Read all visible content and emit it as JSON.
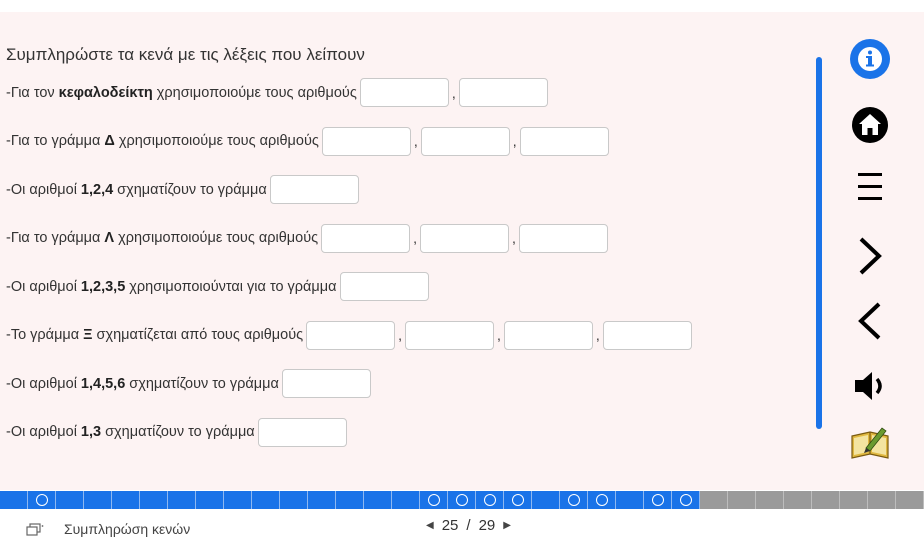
{
  "exercise": {
    "title": "Συμπληρώστε τα κενά με τις λέξεις που λείπουν",
    "lines": [
      {
        "pre": "-Για τον",
        "bold": "κεφαλοδείκτη",
        "post": "χρησιμοποιούμε τους αριθμούς"
      },
      {
        "pre": "-Για το γράμμα",
        "bold": "Δ",
        "post": "χρησιμοποιούμε τους αριθμούς"
      },
      {
        "pre": "-Οι αριθμοί",
        "bold": "1,2,4",
        "post": "σχηματίζουν το γράμμα"
      },
      {
        "pre": "-Για το γράμμα",
        "bold": "Λ",
        "post": "χρησιμοποιούμε τους αριθμούς"
      },
      {
        "pre": "-Οι αριθμοί",
        "bold": "1,2,3,5",
        "post": "χρησιμοποιούνται για το γράμμα"
      },
      {
        "pre": "-Το γράμμα",
        "bold": "Ξ",
        "post": "σχηματίζεται από τους αριθμούς"
      },
      {
        "pre": "-Οι αριθμοί",
        "bold": "1,4,5,6",
        "post": "σχηματίζουν το γράμμα"
      },
      {
        "pre": "-Οι αριθμοί",
        "bold": "1,3",
        "post": "σχηματίζουν το γράμμα"
      }
    ],
    "separator": ","
  },
  "sidebar": {
    "icons": [
      "info-icon",
      "home-icon",
      "menu-icon",
      "next-icon",
      "previous-icon",
      "sound-icon",
      "notebook-icon"
    ],
    "accent": "#1a73e8"
  },
  "footer": {
    "title": "Συμπληρώση κενών",
    "current_page": "25",
    "separator": "/",
    "total_pages": "29"
  },
  "progress": {
    "current_page": 25,
    "total_pages": 29
  },
  "colors": {
    "background": "#fdf3f3",
    "accent": "#1a73e8",
    "progress_inactive": "#9a9a9a"
  }
}
